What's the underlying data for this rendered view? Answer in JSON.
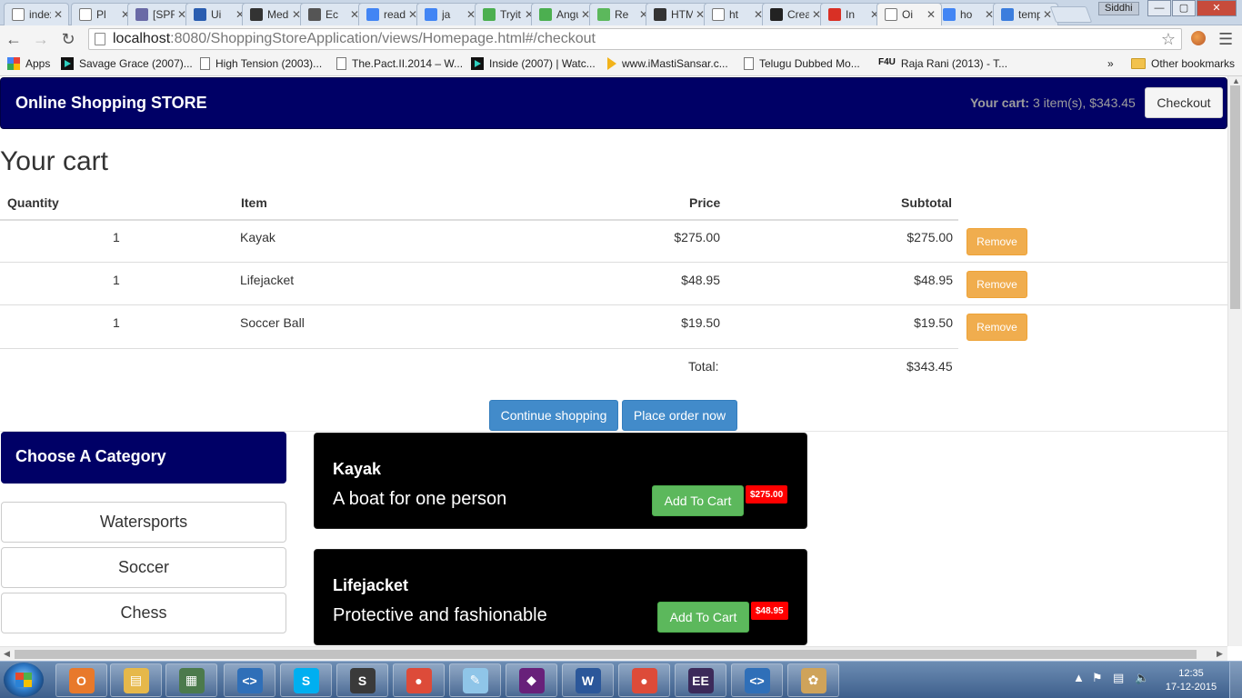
{
  "browser": {
    "tabs": [
      {
        "title": "index",
        "icon": "page-icon",
        "color": "#ffffff"
      },
      {
        "title": "Pl",
        "icon": "page-icon",
        "color": "#ffffff"
      },
      {
        "title": "[SPRT",
        "icon": "car-icon",
        "color": "#6a6aa6"
      },
      {
        "title": "Ui",
        "icon": "x-tool-icon",
        "color": "#2a5db0"
      },
      {
        "title": "Medi",
        "icon": "medium-icon",
        "color": "#333333"
      },
      {
        "title": "Ec",
        "icon": "cloud-icon",
        "color": "#555555"
      },
      {
        "title": "read",
        "icon": "google-icon",
        "color": "#4285f4"
      },
      {
        "title": "ja",
        "icon": "google-icon",
        "color": "#4285f4"
      },
      {
        "title": "Tryit",
        "icon": "w3-icon",
        "color": "#4caf50"
      },
      {
        "title": "Angu",
        "icon": "w3-icon",
        "color": "#4caf50"
      },
      {
        "title": "Re",
        "icon": "leaf-icon",
        "color": "#5cb85c"
      },
      {
        "title": "HTMl",
        "icon": "codepen-icon",
        "color": "#333333"
      },
      {
        "title": "ht",
        "icon": "page-icon",
        "color": "#ffffff"
      },
      {
        "title": "Creat",
        "icon": "github-icon",
        "color": "#222222"
      },
      {
        "title": "In",
        "icon": "gmail-icon",
        "color": "#d93025"
      },
      {
        "title": "Oi",
        "icon": "page-icon",
        "color": "#ffffff"
      },
      {
        "title": "ho",
        "icon": "google-icon",
        "color": "#4285f4"
      },
      {
        "title": "temp",
        "icon": "doc-icon",
        "color": "#3b7ddd"
      }
    ],
    "user": "Siddhi",
    "url_host": "localhost",
    "url_rest": ":8080/ShoppingStoreApplication/views/Homepage.html#/checkout",
    "bookmarks": [
      {
        "label": "Apps",
        "icon": "apps"
      },
      {
        "label": "Savage Grace (2007)...",
        "icon": "play"
      },
      {
        "label": "High Tension (2003)...",
        "icon": "page"
      },
      {
        "label": "The.Pact.II.2014 – W...",
        "icon": "page"
      },
      {
        "label": "Inside (2007) | Watc...",
        "icon": "play"
      },
      {
        "label": "www.iMastiSansar.c...",
        "icon": "yt"
      },
      {
        "label": "Telugu Dubbed Mo...",
        "icon": "page"
      },
      {
        "label": "Raja Rani (2013) - T...",
        "icon": "f4u",
        "prefix": "F4U"
      }
    ],
    "bookmarks_more": "»",
    "other_bookmarks": "Other bookmarks"
  },
  "store": {
    "brand": "Online Shopping STORE",
    "cart_label": "Your cart:",
    "cart_summary": "3 item(s), $343.45",
    "checkout_label": "Checkout"
  },
  "cart": {
    "title": "Your cart",
    "headers": {
      "quantity": "Quantity",
      "item": "Item",
      "price": "Price",
      "subtotal": "Subtotal"
    },
    "rows": [
      {
        "quantity": "1",
        "item": "Kayak",
        "price": "$275.00",
        "subtotal": "$275.00",
        "action": "Remove"
      },
      {
        "quantity": "1",
        "item": "Lifejacket",
        "price": "$48.95",
        "subtotal": "$48.95",
        "action": "Remove"
      },
      {
        "quantity": "1",
        "item": "Soccer Ball",
        "price": "$19.50",
        "subtotal": "$19.50",
        "action": "Remove"
      }
    ],
    "total_label": "Total:",
    "total_value": "$343.45",
    "continue_label": "Continue shopping",
    "place_order_label": "Place order now"
  },
  "categories": {
    "title": "Choose A Category",
    "items": [
      "Watersports",
      "Soccer",
      "Chess"
    ]
  },
  "products": [
    {
      "name": "Kayak",
      "description": "A boat for one person",
      "button": "Add To Cart",
      "price": "$275.00"
    },
    {
      "name": "Lifejacket",
      "description": "Protective and fashionable",
      "button": "Add To Cart",
      "price": "$48.95"
    }
  ],
  "taskbar": {
    "apps": [
      {
        "icon": "outlook-icon",
        "color": "#e8792b",
        "glyph": "O"
      },
      {
        "icon": "explorer-icon",
        "color": "#e6b84a",
        "glyph": "▤"
      },
      {
        "icon": "window-icon",
        "color": "#4c7a4c",
        "glyph": "▦"
      },
      {
        "icon": "vscode-icon",
        "color": "#2f6fb8",
        "glyph": "<>"
      },
      {
        "icon": "skype-icon",
        "color": "#00aff0",
        "glyph": "S"
      },
      {
        "icon": "sublime-icon",
        "color": "#3a3a3a",
        "glyph": "S"
      },
      {
        "icon": "chrome-icon",
        "color": "#dd4b39",
        "glyph": "●"
      },
      {
        "icon": "notepad-icon",
        "color": "#8fc5e8",
        "glyph": "✎"
      },
      {
        "icon": "visualstudio-icon",
        "color": "#68217a",
        "glyph": "◆"
      },
      {
        "icon": "word-icon",
        "color": "#2b579a",
        "glyph": "W"
      },
      {
        "icon": "chrome-icon",
        "color": "#dd4b39",
        "glyph": "●"
      },
      {
        "icon": "eclipse-icon",
        "color": "#3c2a5a",
        "glyph": "EE"
      },
      {
        "icon": "vscode-icon",
        "color": "#2f6fb8",
        "glyph": "<>"
      },
      {
        "icon": "paint-icon",
        "color": "#cfa35a",
        "glyph": "✿"
      }
    ],
    "time": "12:35",
    "date": "17-12-2015"
  }
}
